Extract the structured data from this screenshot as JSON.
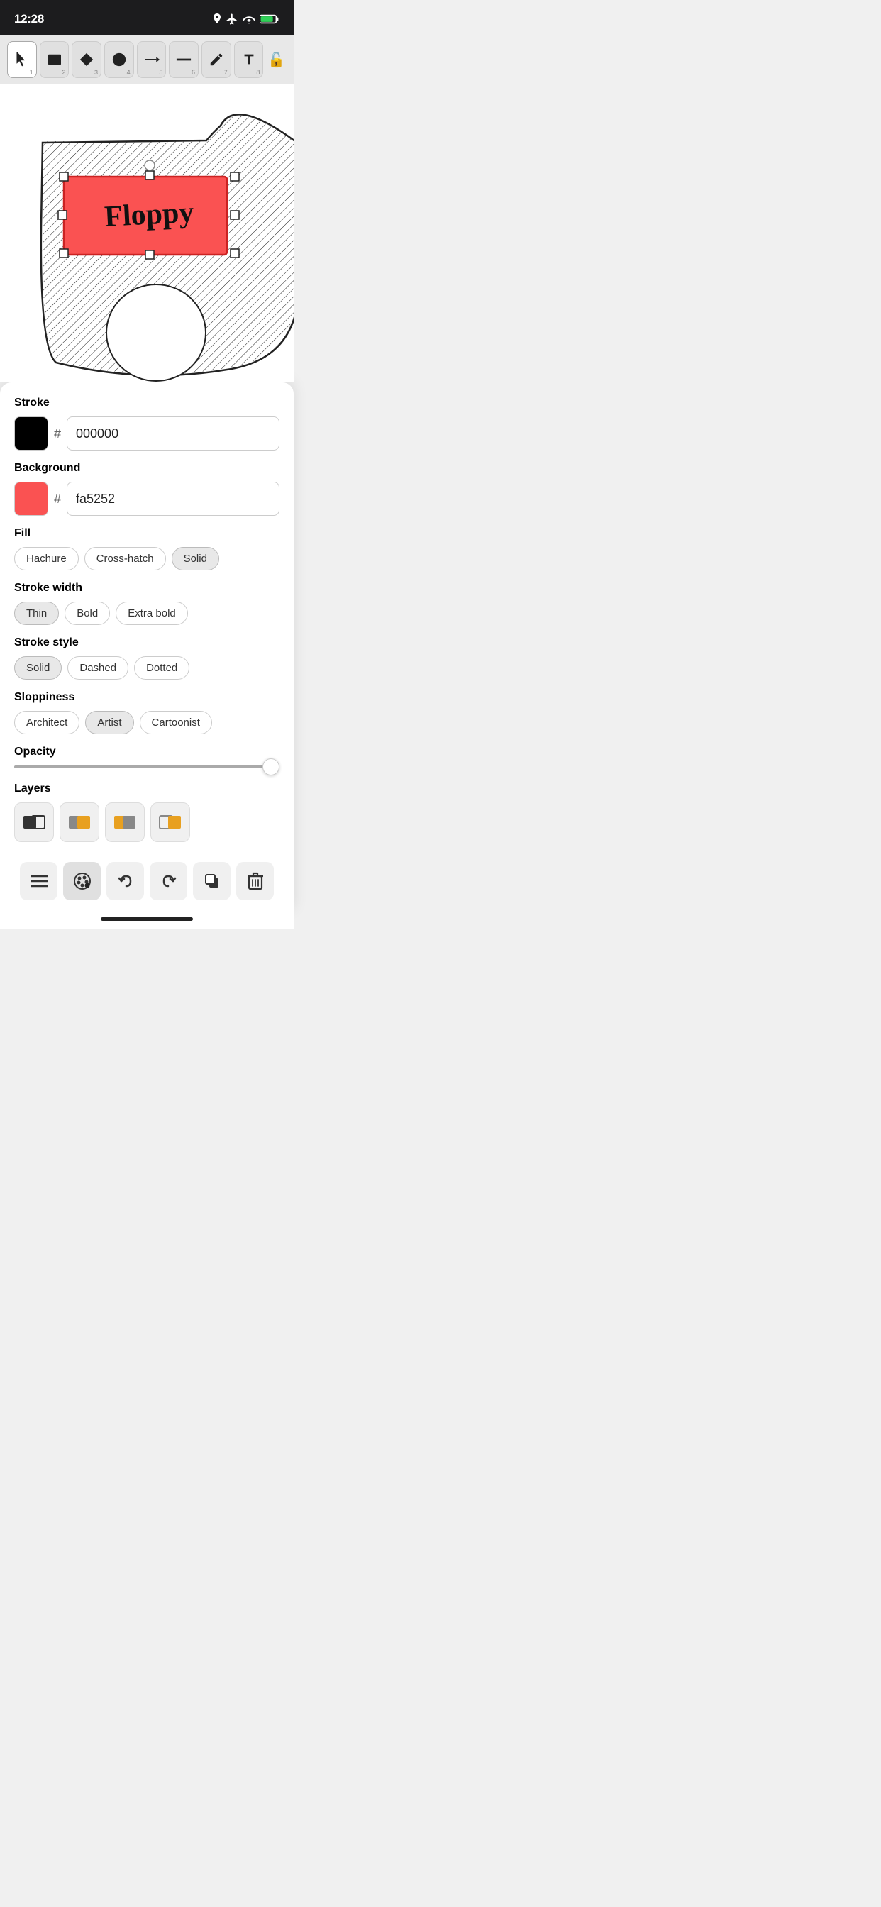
{
  "statusBar": {
    "time": "12:28",
    "icons": [
      "location",
      "airplane",
      "wifi",
      "battery"
    ]
  },
  "toolbar": {
    "tools": [
      {
        "id": "select",
        "symbol": "cursor",
        "num": "1",
        "active": false
      },
      {
        "id": "rectangle",
        "symbol": "rect",
        "num": "2",
        "active": false
      },
      {
        "id": "diamond",
        "symbol": "diamond",
        "num": "3",
        "active": false
      },
      {
        "id": "ellipse",
        "symbol": "ellipse",
        "num": "4",
        "active": false
      },
      {
        "id": "arrow",
        "symbol": "arrow",
        "num": "5",
        "active": false
      },
      {
        "id": "line",
        "symbol": "line",
        "num": "6",
        "active": false
      },
      {
        "id": "pen",
        "symbol": "pen",
        "num": "7",
        "active": false
      },
      {
        "id": "text",
        "symbol": "text",
        "num": "8",
        "active": false
      }
    ],
    "lockLabel": "🔓"
  },
  "properties": {
    "stroke": {
      "label": "Stroke",
      "color": "#000000",
      "hex": "000000"
    },
    "background": {
      "label": "Background",
      "color": "#fa5252",
      "hex": "fa5252"
    },
    "fill": {
      "label": "Fill",
      "options": [
        "Hachure",
        "Cross-hatch",
        "Solid"
      ],
      "active": "Solid"
    },
    "strokeWidth": {
      "label": "Stroke width",
      "options": [
        "Thin",
        "Bold",
        "Extra bold"
      ],
      "active": "Thin"
    },
    "strokeStyle": {
      "label": "Stroke style",
      "options": [
        "Solid",
        "Dashed",
        "Dotted"
      ],
      "active": "Solid"
    },
    "sloppiness": {
      "label": "Sloppiness",
      "options": [
        "Architect",
        "Artist",
        "Cartoonist"
      ],
      "active": "Artist"
    },
    "opacity": {
      "label": "Opacity",
      "value": 100
    },
    "layers": {
      "label": "Layers",
      "items": [
        {
          "id": "layer1",
          "type": "overlap-black"
        },
        {
          "id": "layer2",
          "type": "overlap-orange"
        },
        {
          "id": "layer3",
          "type": "overlap-mixed"
        },
        {
          "id": "layer4",
          "type": "overlap-orange2"
        }
      ]
    }
  },
  "bottomActions": [
    {
      "id": "hamburger",
      "symbol": "≡",
      "active": false
    },
    {
      "id": "palette",
      "symbol": "palette",
      "active": true
    },
    {
      "id": "undo",
      "symbol": "undo",
      "active": false
    },
    {
      "id": "redo",
      "symbol": "redo",
      "active": false
    },
    {
      "id": "copy",
      "symbol": "copy",
      "active": false
    },
    {
      "id": "trash",
      "symbol": "trash",
      "active": false
    }
  ]
}
